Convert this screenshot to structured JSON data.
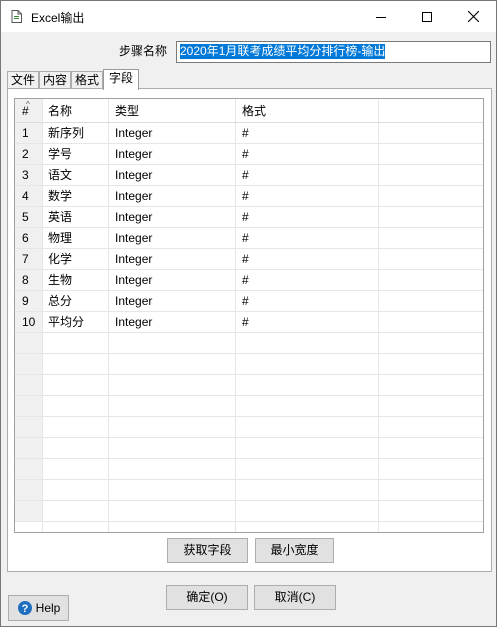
{
  "window": {
    "title": "Excel输出",
    "icon": "document-icon",
    "controls": {
      "minimize": "minimize-icon",
      "maximize": "maximize-icon",
      "close": "close-icon"
    }
  },
  "step": {
    "label": "步骤名称",
    "value": "2020年1月联考成绩平均分排行榜-输出"
  },
  "tabs": [
    {
      "label": "文件",
      "active": false
    },
    {
      "label": "内容",
      "active": false
    },
    {
      "label": "格式",
      "active": false
    },
    {
      "label": "字段",
      "active": true
    }
  ],
  "table": {
    "columns": [
      "#",
      "名称",
      "类型",
      "格式"
    ],
    "rows": [
      {
        "num": "1",
        "name": "新序列",
        "type": "Integer",
        "format": "#"
      },
      {
        "num": "2",
        "name": "学号",
        "type": "Integer",
        "format": "#"
      },
      {
        "num": "3",
        "name": "语文",
        "type": "Integer",
        "format": "#"
      },
      {
        "num": "4",
        "name": "数学",
        "type": "Integer",
        "format": "#"
      },
      {
        "num": "5",
        "name": "英语",
        "type": "Integer",
        "format": "#"
      },
      {
        "num": "6",
        "name": "物理",
        "type": "Integer",
        "format": "#"
      },
      {
        "num": "7",
        "name": "化学",
        "type": "Integer",
        "format": "#"
      },
      {
        "num": "8",
        "name": "生物",
        "type": "Integer",
        "format": "#"
      },
      {
        "num": "9",
        "name": "总分",
        "type": "Integer",
        "format": "#"
      },
      {
        "num": "10",
        "name": "平均分",
        "type": "Integer",
        "format": "#"
      }
    ]
  },
  "buttons": {
    "get_fields": "获取字段",
    "min_width": "最小宽度",
    "ok": "确定(O)",
    "cancel": "取消(C)",
    "help": "Help"
  },
  "colors": {
    "selection": "#0078d7",
    "window_bg": "#f0f0f0",
    "help_icon": "#1e6fc0"
  }
}
